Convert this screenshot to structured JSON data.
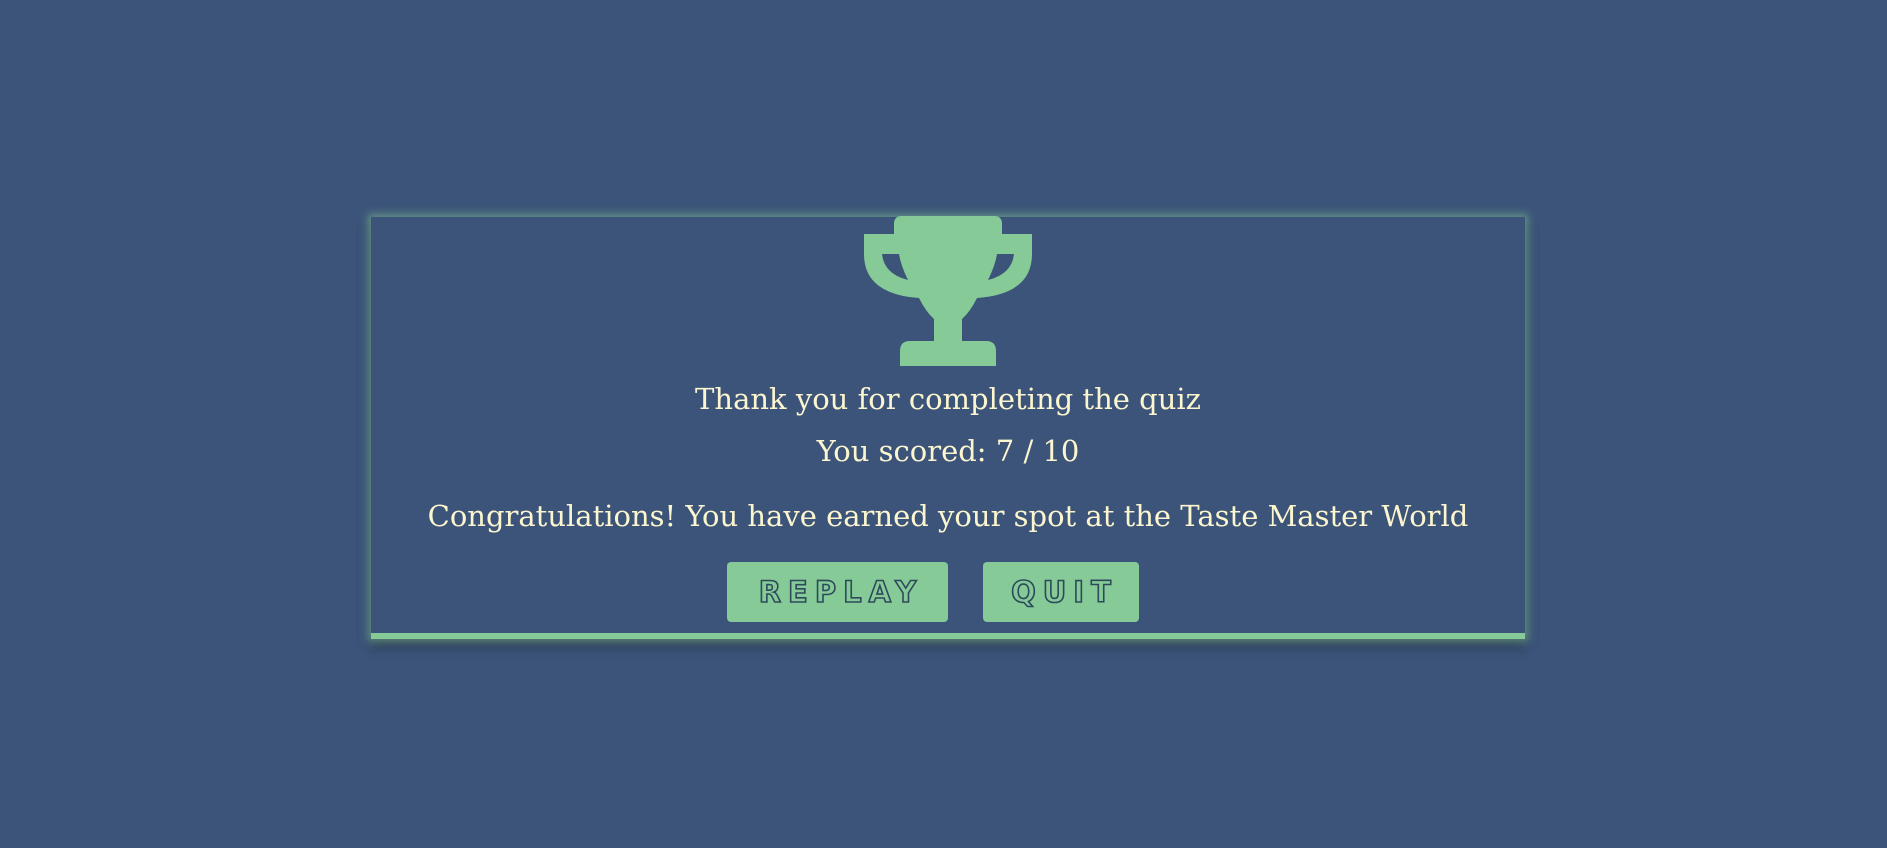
{
  "colors": {
    "background": "#3c5479",
    "accent": "#86cb97",
    "text": "#fbf6cf"
  },
  "result": {
    "icon": "trophy-icon",
    "thanks": "Thank you for completing the quiz",
    "score": "You scored: 7 / 10",
    "message": "Congratulations! You have earned your spot at the Taste Master World"
  },
  "buttons": {
    "replay_label": "REPLAY",
    "quit_label": "QUIT"
  }
}
